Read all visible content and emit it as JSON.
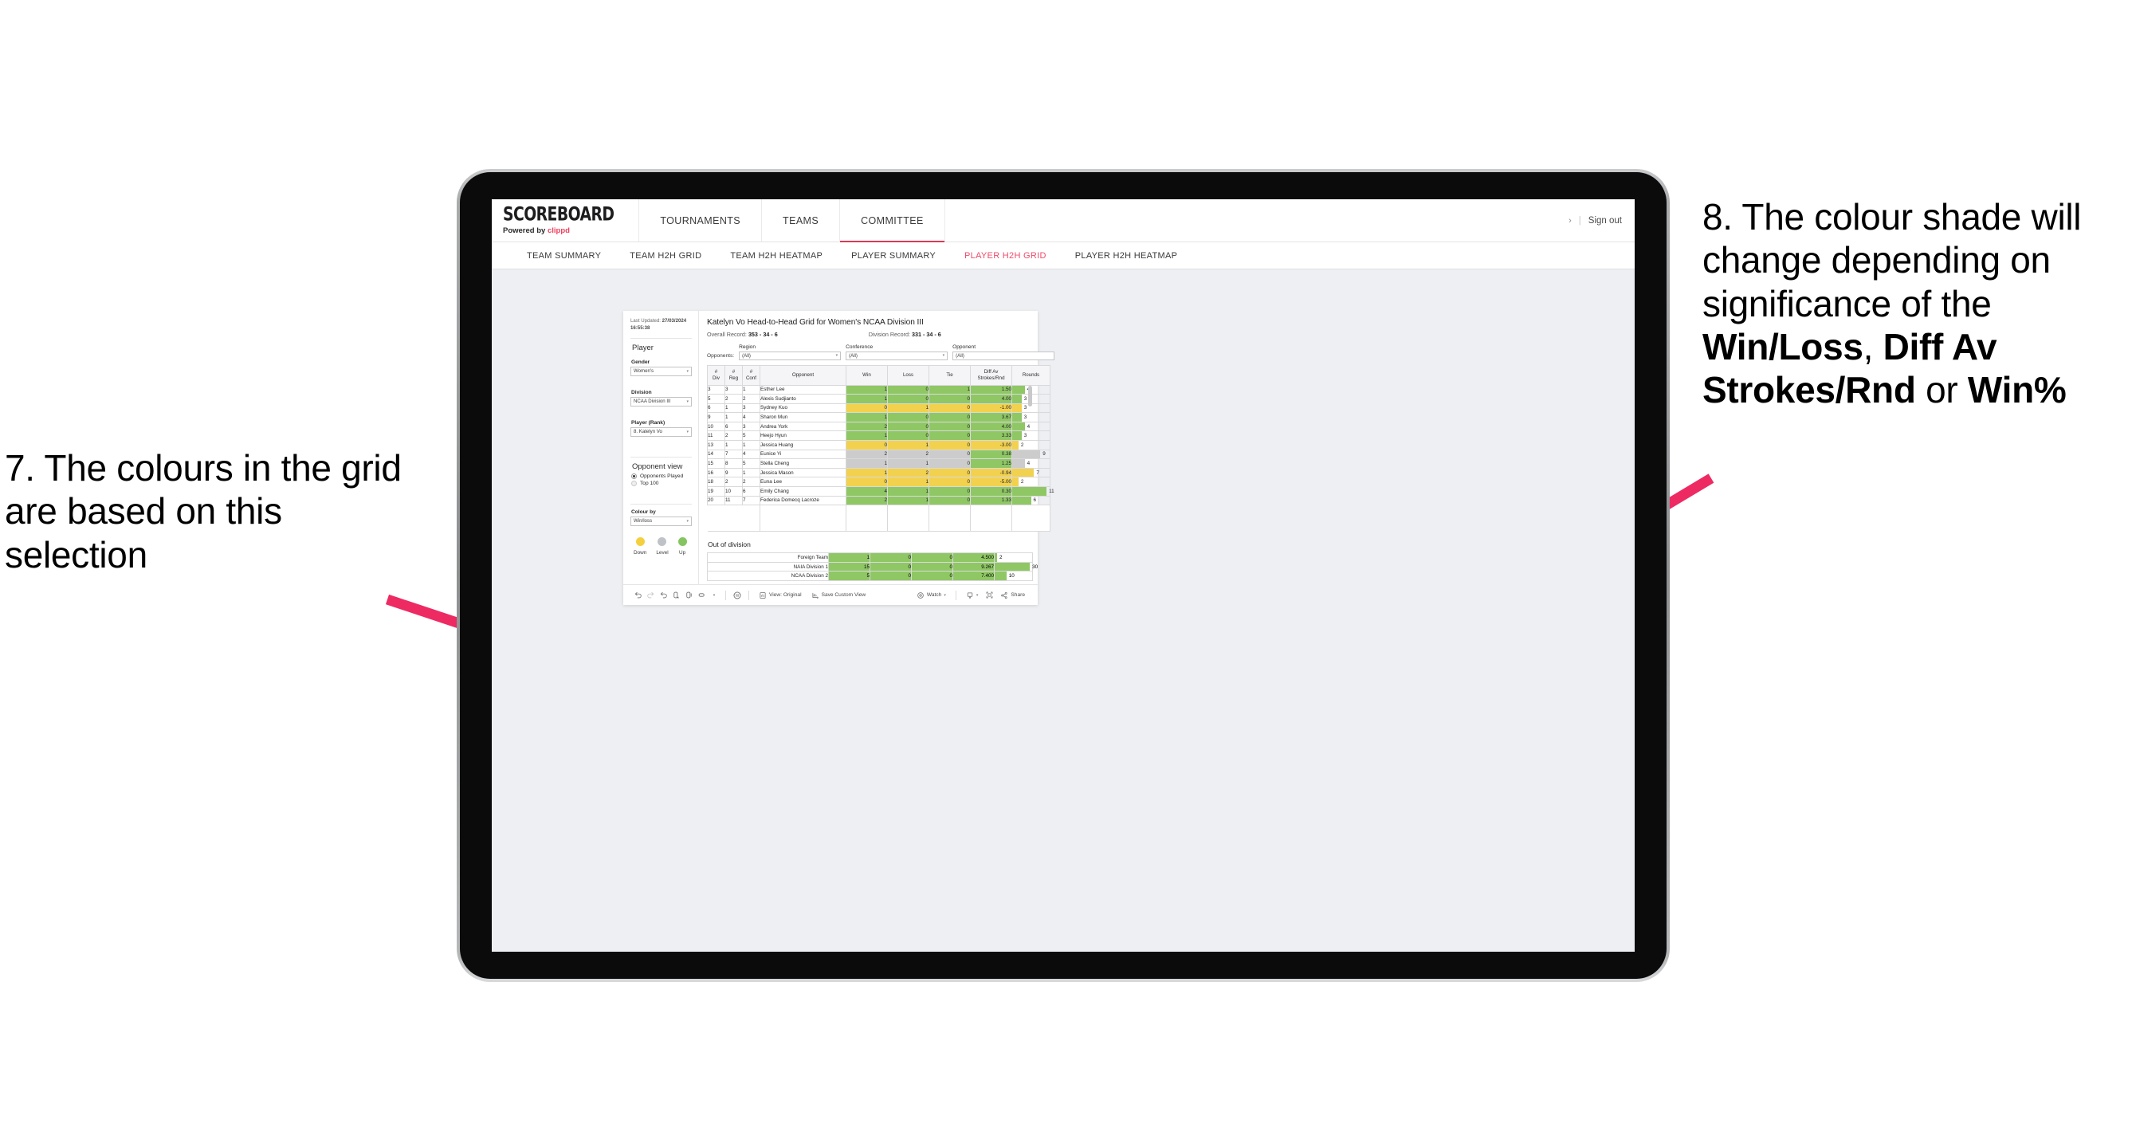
{
  "annotations": {
    "left": {
      "id": "annot-7",
      "text": "7. The colours in the grid are based on this selection"
    },
    "right": {
      "id": "annot-8",
      "prefix": "8. The colour shade will change depending on significance of the ",
      "bold1": "Win/Loss",
      "mid1": ", ",
      "bold2": "Diff Av Strokes/Rnd",
      "mid2": " or ",
      "bold3": "Win%"
    },
    "arrow_color": "#ee2a62"
  },
  "header": {
    "brand_name": "SCOREBOARD",
    "brand_sub_prefix": "Powered by ",
    "brand_sub_link": "clippd",
    "nav": [
      {
        "label": "TOURNAMENTS",
        "active": false
      },
      {
        "label": "TEAMS",
        "active": false
      },
      {
        "label": "COMMITTEE",
        "active": true
      }
    ],
    "chevron": "›",
    "divider": "|",
    "sign_out": "Sign out"
  },
  "subnav": [
    {
      "label": "TEAM SUMMARY",
      "active": false
    },
    {
      "label": "TEAM H2H GRID",
      "active": false
    },
    {
      "label": "TEAM H2H HEATMAP",
      "active": false
    },
    {
      "label": "PLAYER SUMMARY",
      "active": false
    },
    {
      "label": "PLAYER H2H GRID",
      "active": true
    },
    {
      "label": "PLAYER H2H HEATMAP",
      "active": false
    }
  ],
  "sidebar": {
    "last_updated_label": "Last Updated:",
    "last_updated_value": "27/03/2024 16:55:38",
    "player_heading": "Player",
    "gender_label": "Gender",
    "gender_value": "Women's",
    "division_label": "Division",
    "division_value": "NCAA Division III",
    "player_rank_label": "Player (Rank)",
    "player_rank_value": "8. Katelyn Vo",
    "opponent_view_heading": "Opponent view",
    "opponent_view_options": [
      {
        "label": "Opponents Played",
        "selected": true
      },
      {
        "label": "Top 100",
        "selected": false
      }
    ],
    "colour_by_label": "Colour by",
    "colour_by_value": "Win/loss",
    "legend": [
      {
        "label": "Down",
        "color": "#f4d03f"
      },
      {
        "label": "Level",
        "color": "#bfc3c7"
      },
      {
        "label": "Up",
        "color": "#84c561"
      }
    ],
    "caret": "▾"
  },
  "main": {
    "title": "Katelyn Vo Head-to-Head Grid for Women's NCAA Division III",
    "overall_record_label": "Overall Record:",
    "overall_record_value": "353 -  34 - 6",
    "division_record_label": "Division Record:",
    "division_record_value": "331 -  34 - 6",
    "opponents_label": "Opponents:",
    "filters": [
      {
        "label": "Region",
        "value": "(All)"
      },
      {
        "label": "Conference",
        "value": "(All)"
      },
      {
        "label": "Opponent",
        "value": "(All)"
      }
    ],
    "caret": "▾"
  },
  "chart_data": {
    "type": "table",
    "title": "Katelyn Vo Head-to-Head Grid for Women's NCAA Division III",
    "columns": [
      {
        "key": "div",
        "header_top": "#",
        "header_bottom": "Div"
      },
      {
        "key": "reg",
        "header_top": "#",
        "header_bottom": "Reg"
      },
      {
        "key": "conf",
        "header_top": "#",
        "header_bottom": "Conf"
      },
      {
        "key": "opponent",
        "header_top": "Opponent",
        "header_bottom": ""
      },
      {
        "key": "win",
        "header_top": "Win",
        "header_bottom": ""
      },
      {
        "key": "loss",
        "header_top": "Loss",
        "header_bottom": ""
      },
      {
        "key": "tie",
        "header_top": "Tie",
        "header_bottom": ""
      },
      {
        "key": "diff",
        "header_top": "Diff Av",
        "header_bottom": "Strokes/Rnd"
      },
      {
        "key": "rounds",
        "header_top": "Rounds",
        "header_bottom": ""
      }
    ],
    "colors": {
      "up": "#8fc765",
      "down": "#f2d14e",
      "level": "#cccccc",
      "none": "#ffffff"
    },
    "rows": [
      {
        "div": "3",
        "reg": "3",
        "conf": "1",
        "opponent": "Esther Lee",
        "win": "1",
        "loss": "0",
        "tie": "1",
        "diff": "1.50",
        "rounds": 4,
        "status": "up"
      },
      {
        "div": "5",
        "reg": "2",
        "conf": "2",
        "opponent": "Alexis Sudjianto",
        "win": "1",
        "loss": "0",
        "tie": "0",
        "diff": "4.00",
        "rounds": 3,
        "status": "up"
      },
      {
        "div": "6",
        "reg": "1",
        "conf": "3",
        "opponent": "Sydney Kuo",
        "win": "0",
        "loss": "1",
        "tie": "0",
        "diff": "-1.00",
        "rounds": 3,
        "status": "down"
      },
      {
        "div": "9",
        "reg": "1",
        "conf": "4",
        "opponent": "Sharon Mun",
        "win": "1",
        "loss": "0",
        "tie": "0",
        "diff": "3.67",
        "rounds": 3,
        "status": "up"
      },
      {
        "div": "10",
        "reg": "6",
        "conf": "3",
        "opponent": "Andrea York",
        "win": "2",
        "loss": "0",
        "tie": "0",
        "diff": "4.00",
        "rounds": 4,
        "status": "up"
      },
      {
        "div": "11",
        "reg": "2",
        "conf": "5",
        "opponent": "Heejo Hyun",
        "win": "1",
        "loss": "0",
        "tie": "0",
        "diff": "3.33",
        "rounds": 3,
        "status": "up"
      },
      {
        "div": "13",
        "reg": "1",
        "conf": "1",
        "opponent": "Jessica Huang",
        "win": "0",
        "loss": "1",
        "tie": "0",
        "diff": "-3.00",
        "rounds": 2,
        "status": "down"
      },
      {
        "div": "14",
        "reg": "7",
        "conf": "4",
        "opponent": "Eunice Yi",
        "win": "2",
        "loss": "2",
        "tie": "0",
        "diff": "0.38",
        "rounds": 9,
        "status": "level",
        "diff_status": "up"
      },
      {
        "div": "15",
        "reg": "8",
        "conf": "5",
        "opponent": "Stella Cheng",
        "win": "1",
        "loss": "1",
        "tie": "0",
        "diff": "1.25",
        "rounds": 4,
        "status": "level",
        "diff_status": "up"
      },
      {
        "div": "16",
        "reg": "9",
        "conf": "1",
        "opponent": "Jessica Mason",
        "win": "1",
        "loss": "2",
        "tie": "0",
        "diff": "-0.94",
        "rounds": 7,
        "status": "down"
      },
      {
        "div": "18",
        "reg": "2",
        "conf": "2",
        "opponent": "Euna Lee",
        "win": "0",
        "loss": "1",
        "tie": "0",
        "diff": "-5.00",
        "rounds": 2,
        "status": "down"
      },
      {
        "div": "19",
        "reg": "10",
        "conf": "6",
        "opponent": "Emily Chang",
        "win": "4",
        "loss": "1",
        "tie": "0",
        "diff": "0.30",
        "rounds": 11,
        "status": "up"
      },
      {
        "div": "20",
        "reg": "11",
        "conf": "7",
        "opponent": "Federica Domecq Lacroze",
        "win": "2",
        "loss": "1",
        "tie": "0",
        "diff": "1.33",
        "rounds": 6,
        "status": "up"
      }
    ],
    "rounds_max": 12,
    "out_of_division": {
      "title": "Out of division",
      "rows": [
        {
          "opponent": "Foreign Team",
          "win": "1",
          "loss": "0",
          "tie": "0",
          "diff": "4.500",
          "rounds": 2,
          "status": "up"
        },
        {
          "opponent": "NAIA Division 1",
          "win": "15",
          "loss": "0",
          "tie": "0",
          "diff": "9.267",
          "rounds": 30,
          "status": "up"
        },
        {
          "opponent": "NCAA Division 2",
          "win": "5",
          "loss": "0",
          "tie": "0",
          "diff": "7.400",
          "rounds": 10,
          "status": "up"
        }
      ],
      "rounds_max": 32
    }
  },
  "toolbar": {
    "view_label": "View: Original",
    "save_label": "Save Custom View",
    "watch_label": "Watch",
    "share_label": "Share",
    "caret": "▾"
  }
}
